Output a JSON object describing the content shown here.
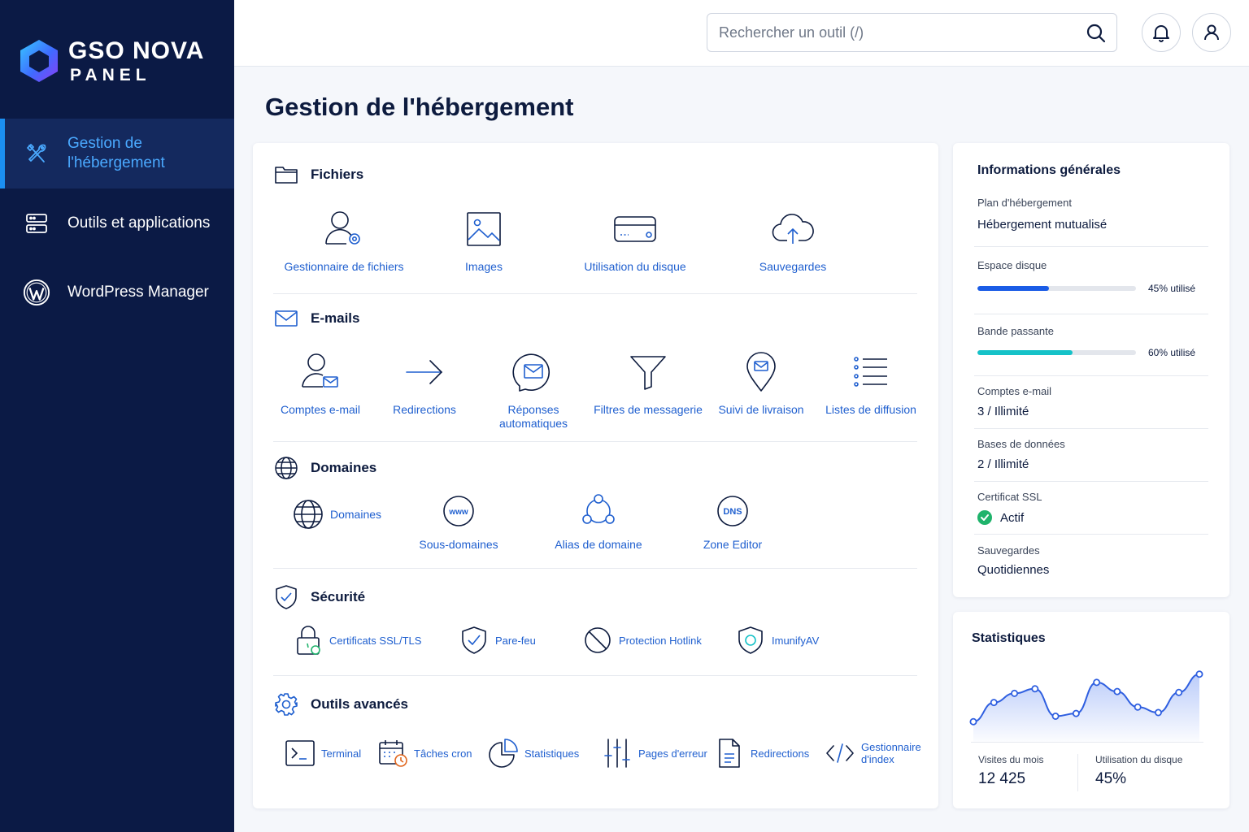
{
  "brand": {
    "line1": "GSO NOVA",
    "line2": "PANEL"
  },
  "sidebar": {
    "items": [
      {
        "label": "Gestion de l'hébergement",
        "icon": "tools-icon",
        "active": true
      },
      {
        "label": "Outils et applications",
        "icon": "server-icon",
        "active": false
      },
      {
        "label": "WordPress Manager",
        "icon": "wordpress-icon",
        "active": false
      }
    ]
  },
  "header": {
    "search_placeholder": "Rechercher un outil (/)"
  },
  "page": {
    "title": "Gestion de l'hébergement"
  },
  "sections": {
    "files": {
      "title": "Fichiers",
      "tools": [
        "Gestionnaire de fichiers",
        "Images",
        "Utilisation du disque",
        "Sauvegardes"
      ]
    },
    "emails": {
      "title": "E-mails",
      "tools": [
        "Comptes e-mail",
        "Redirections",
        "Réponses automatiques",
        "Filtres de messagerie",
        "Suivi de livraison",
        "Listes de diffusion"
      ]
    },
    "domains": {
      "title": "Domaines",
      "tools": [
        "Domaines",
        "Sous-domaines",
        "Alias de domaine",
        "Zone Editor"
      ],
      "www_text": "www",
      "dns_text": "DNS"
    },
    "security": {
      "title": "Sécurité",
      "tools": [
        "Certificats SSL/TLS",
        "Pare-feu",
        "Protection Hotlink",
        "ImunifyAV"
      ]
    },
    "advanced": {
      "title": "Outils avancés",
      "tools": [
        "Terminal",
        "Tâches cron",
        "Statistiques",
        "Pages d'erreur",
        "Redirections",
        "Gestionnaire d'index"
      ]
    }
  },
  "info": {
    "title": "Informations générales",
    "plan_label": "Plan d'hébergement",
    "plan_value": "Hébergement mutualisé",
    "disk_label": "Espace disque",
    "disk_percent": 45,
    "disk_text": "45% utilisé",
    "bandwidth_label": "Bande passante",
    "bandwidth_percent": 60,
    "bandwidth_text": "60% utilisé",
    "email_label": "Comptes e-mail",
    "email_value": "3 / Illimité",
    "db_label": "Bases de données",
    "db_value": "2 / Illimité",
    "ssl_label": "Certificat SSL",
    "ssl_value": "Actif",
    "backup_label": "Sauvegardes",
    "backup_value": "Quotidiennes"
  },
  "stats": {
    "title": "Statistiques",
    "visits_label": "Visites du mois",
    "visits_value": "12 425",
    "disk_label": "Utilisation du disque",
    "disk_value": "45%"
  },
  "chart_data": {
    "type": "area",
    "values": [
      22,
      43,
      53,
      58,
      28,
      31,
      65,
      55,
      38,
      32,
      54,
      74
    ]
  },
  "colors": {
    "sidebar": "#0b1a45",
    "accent": "#1b8ff2",
    "link": "#1f5fcf",
    "disk_bar": "#1a5ce6",
    "bandwidth_bar": "#15c2c8",
    "success": "#1fb36b"
  }
}
